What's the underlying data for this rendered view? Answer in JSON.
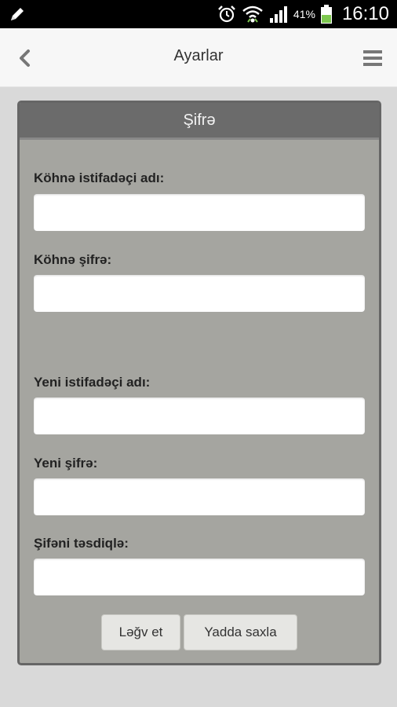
{
  "status_bar": {
    "battery_percent": "41%",
    "time": "16:10",
    "icons": [
      "pencil-icon",
      "alarm-icon",
      "wifi-icon",
      "signal-icon",
      "battery-icon"
    ]
  },
  "action_bar": {
    "title": "Ayarlar",
    "back_icon": "chevron-left-icon",
    "menu_icon": "hamburger-menu-icon"
  },
  "panel": {
    "title": "Şifrə",
    "fields": {
      "old_username": {
        "label": "Köhnə istifadəçi adı:",
        "value": ""
      },
      "old_password": {
        "label": "Köhnə şifrə:",
        "value": ""
      },
      "new_username": {
        "label": "Yeni istifadəçi adı:",
        "value": ""
      },
      "new_password": {
        "label": "Yeni şifrə:",
        "value": ""
      },
      "confirm_password": {
        "label": "Şifəni təsdiqlə:",
        "value": ""
      }
    },
    "buttons": {
      "cancel": "Ləğv et",
      "save": "Yadda saxla"
    }
  },
  "colors": {
    "panel_bg": "#a5a5a0",
    "panel_header_bg": "#6b6b6b",
    "page_bg": "#d9d9d9",
    "battery_green": "#7ec850"
  }
}
